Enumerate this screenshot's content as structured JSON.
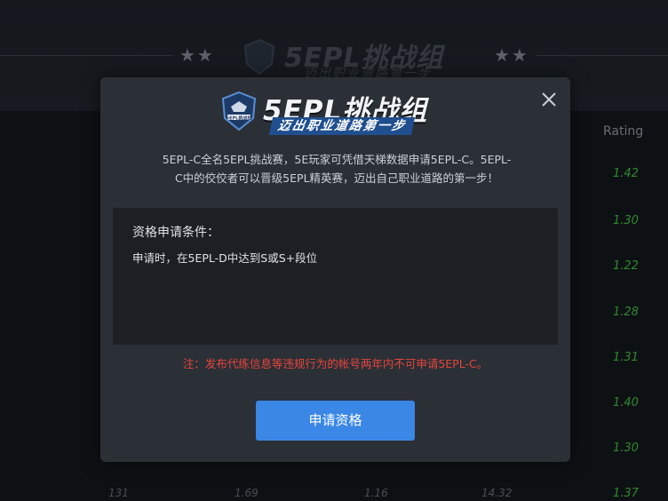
{
  "background": {
    "brand": "5EPL挑战组",
    "tagline": "迈出职业道路第一步",
    "stars_left": "★★",
    "stars_right": "★★",
    "rating_header": "Rating",
    "ratings": [
      "1.42",
      "1.30",
      "1.22",
      "1.28",
      "1.31",
      "1.40",
      "1.30",
      "1.37"
    ],
    "bottom_row": [
      "131",
      "1.69",
      "1.16",
      "14.32"
    ]
  },
  "modal": {
    "logo_text": "5EPL挑战组",
    "brand": "5EPL挑战组",
    "tagline": "迈出职业道路第一步",
    "description_line1": "5EPL-C全名5EPL挑战赛，5E玩家可凭借天梯数据申请5EPL-C。5EPL-",
    "description_line2": "C中的佼佼者可以晋级5EPL精英赛，迈出自己职业道路的第一步！",
    "conditions_title": "资格申请条件：",
    "conditions_text": "申请时，在5EPL-D中达到S或S+段位",
    "note": "注：发布代练信息等违规行为的帐号两年内不可申请5EPL-C。",
    "apply_button": "申请资格"
  },
  "colors": {
    "accent_button": "#3a87e6",
    "warning_text": "#e8463c",
    "rating_green": "#47c944"
  }
}
